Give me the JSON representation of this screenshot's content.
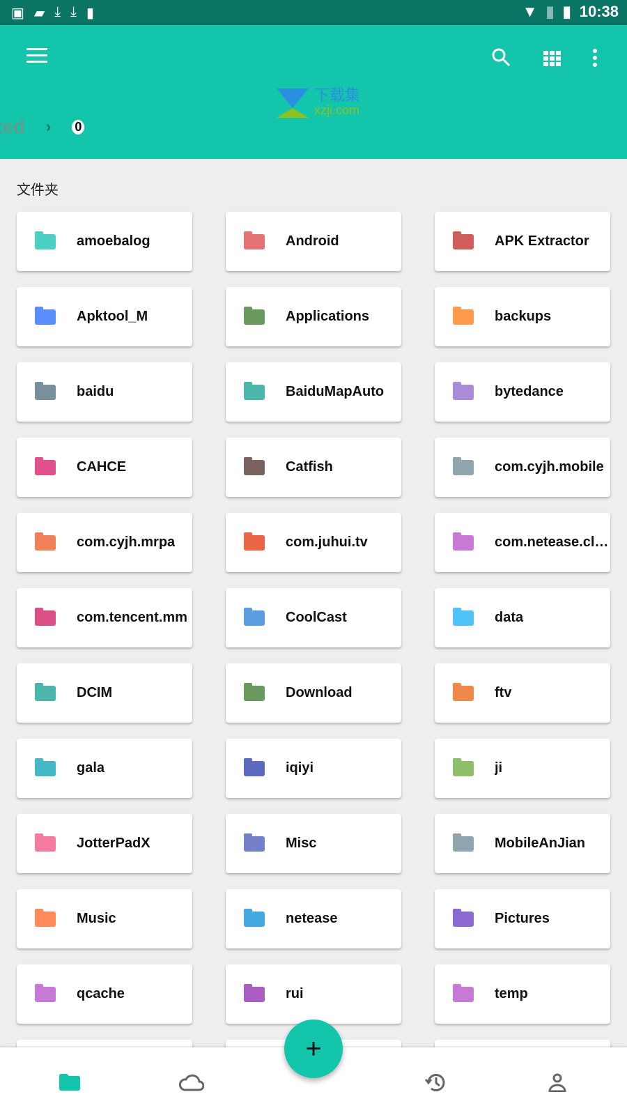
{
  "status": {
    "time": "10:38"
  },
  "toolbar": {
    "breadcrumb": [
      "ted",
      "0"
    ]
  },
  "watermark": {
    "cn": "下载集",
    "url": "xzji.com"
  },
  "section_title": "文件夹",
  "accent": "#13c5ab",
  "folders": [
    {
      "name": "amoebalog",
      "color": "#4dd0c4"
    },
    {
      "name": "Android",
      "color": "#e57373"
    },
    {
      "name": "APK Extractor",
      "color": "#d05c5c"
    },
    {
      "name": "Apktool_M",
      "color": "#5c8dff"
    },
    {
      "name": "Applications",
      "color": "#6a9a5e"
    },
    {
      "name": "backups",
      "color": "#ff9a4a"
    },
    {
      "name": "baidu",
      "color": "#78909c"
    },
    {
      "name": "BaiduMapAuto",
      "color": "#4db6ac"
    },
    {
      "name": "bytedance",
      "color": "#a98bd8"
    },
    {
      "name": "CAHCE",
      "color": "#e0508a"
    },
    {
      "name": "Catfish",
      "color": "#7a6260"
    },
    {
      "name": "com.cyjh.mobile",
      "color": "#90a4ae"
    },
    {
      "name": "com.cyjh.mrpa",
      "color": "#f0805a"
    },
    {
      "name": "com.juhui.tv",
      "color": "#ea6446"
    },
    {
      "name": "com.netease.cloudmusic",
      "color": "#c77ad5"
    },
    {
      "name": "com.tencent.mm",
      "color": "#da4f86"
    },
    {
      "name": "CoolCast",
      "color": "#5a9ee0"
    },
    {
      "name": "data",
      "color": "#4fc3f7"
    },
    {
      "name": "DCIM",
      "color": "#4db6ac"
    },
    {
      "name": "Download",
      "color": "#6a9a5e"
    },
    {
      "name": "ftv",
      "color": "#f0884a"
    },
    {
      "name": "gala",
      "color": "#44b8c4"
    },
    {
      "name": "iqiyi",
      "color": "#5c6bc0"
    },
    {
      "name": "ji",
      "color": "#8fbf6a"
    },
    {
      "name": "JotterPadX",
      "color": "#f67ba0"
    },
    {
      "name": "Misc",
      "color": "#7480c8"
    },
    {
      "name": "MobileAnJian",
      "color": "#90a4ae"
    },
    {
      "name": "Music",
      "color": "#ff8a5c"
    },
    {
      "name": "netease",
      "color": "#45a8e0"
    },
    {
      "name": "Pictures",
      "color": "#8a6ad0"
    },
    {
      "name": "qcache",
      "color": "#c77ad5"
    },
    {
      "name": "rui",
      "color": "#ab5cc0"
    },
    {
      "name": "temp",
      "color": "#c77ad5"
    },
    {
      "name": "",
      "color": "#ffffff"
    },
    {
      "name": "",
      "color": "#ffffff"
    },
    {
      "name": "",
      "color": "#ffffff"
    }
  ],
  "bottom_nav": [
    "folder-icon",
    "cloud-icon",
    "history-icon",
    "person-icon"
  ],
  "fab": "+"
}
